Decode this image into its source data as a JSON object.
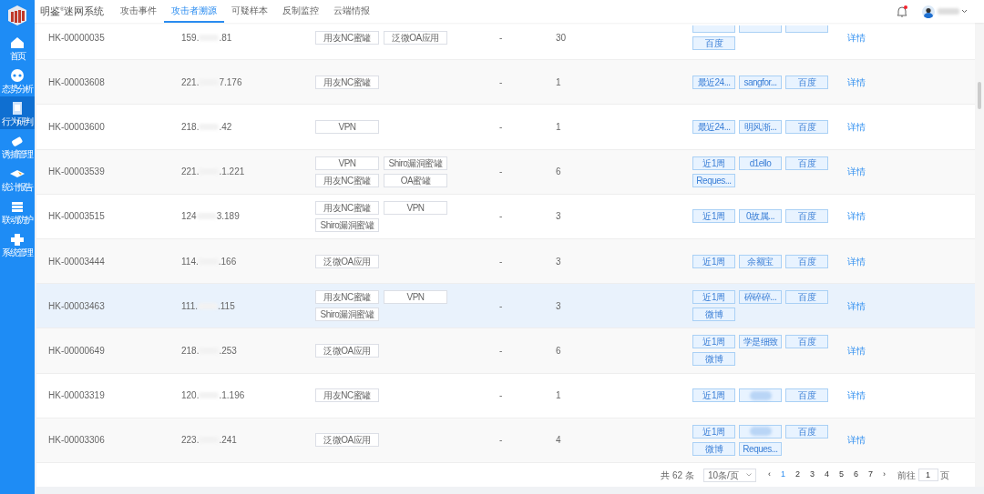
{
  "app": {
    "title": "明鉴$^{®}$迷网系统"
  },
  "sidebar": {
    "items": [
      {
        "label": "首页",
        "selected": false
      },
      {
        "label": "态势分析",
        "selected": false
      },
      {
        "label": "行为研判",
        "selected": true
      },
      {
        "label": "诱捕管理",
        "selected": false
      },
      {
        "label": "统计报告",
        "selected": false
      },
      {
        "label": "联动防护",
        "selected": false
      },
      {
        "label": "系统管理",
        "selected": false
      }
    ]
  },
  "tabs": [
    {
      "label": "攻击事件",
      "selected": false
    },
    {
      "label": "攻击者溯源",
      "selected": true
    },
    {
      "label": "可疑样本",
      "selected": false
    },
    {
      "label": "反制监控",
      "selected": false
    },
    {
      "label": "云端情报",
      "selected": false
    }
  ],
  "header": {
    "notifications": {
      "unread": true
    }
  },
  "table": {
    "rows": [
      {
        "id": "HK-00000035",
        "ip_start": "159.",
        "ip_end": ".81",
        "tags": [
          "用友NC蜜罐",
          "泛微OA应用"
        ],
        "dash": "-",
        "count": "30",
        "intel": [
          {
            "kind": "clipped"
          },
          {
            "kind": "clipped"
          },
          {
            "kind": "clipped"
          },
          {
            "kind": "text",
            "text": "百度"
          }
        ],
        "action": "详情",
        "highlighted": false
      },
      {
        "id": "HK-00003608",
        "ip_start": "221.",
        "ip_end": "7.176",
        "tags": [
          "用友NC蜜罐"
        ],
        "dash": "-",
        "count": "1",
        "intel": [
          {
            "kind": "text",
            "text": "最近24..."
          },
          {
            "kind": "text",
            "text": "sangfor..."
          },
          {
            "kind": "text",
            "text": "百度"
          }
        ],
        "action": "详情",
        "highlighted": false
      },
      {
        "id": "HK-00003600",
        "ip_start": "218.",
        "ip_end": ".42",
        "tags": [
          "VPN"
        ],
        "dash": "-",
        "count": "1",
        "intel": [
          {
            "kind": "text",
            "text": "最近24..."
          },
          {
            "kind": "text",
            "text": "明风渐..."
          },
          {
            "kind": "text",
            "text": "百度"
          }
        ],
        "action": "详情",
        "highlighted": false
      },
      {
        "id": "HK-00003539",
        "ip_start": "221.",
        "ip_end": ".1.221",
        "tags": [
          "VPN",
          "Shiro漏洞蜜罐",
          "用友NC蜜罐",
          "OA蜜罐"
        ],
        "dash": "-",
        "count": "6",
        "intel": [
          {
            "kind": "text",
            "text": "近1周"
          },
          {
            "kind": "text",
            "text": "d1ello"
          },
          {
            "kind": "text",
            "text": "百度"
          },
          {
            "kind": "text",
            "text": "Reques..."
          }
        ],
        "action": "详情",
        "highlighted": false
      },
      {
        "id": "HK-00003515",
        "ip_start": "124",
        "ip_end": "3.189",
        "tags": [
          "用友NC蜜罐",
          "VPN",
          "Shiro漏洞蜜罐"
        ],
        "dash": "-",
        "count": "3",
        "intel": [
          {
            "kind": "text",
            "text": "近1周"
          },
          {
            "kind": "text",
            "text": "0故属..."
          },
          {
            "kind": "text",
            "text": "百度"
          }
        ],
        "action": "详情",
        "highlighted": false
      },
      {
        "id": "HK-00003444",
        "ip_start": "114.",
        "ip_end": ".166",
        "tags": [
          "泛微OA应用"
        ],
        "dash": "-",
        "count": "3",
        "intel": [
          {
            "kind": "text",
            "text": "近1周"
          },
          {
            "kind": "text",
            "text": "余额宝"
          },
          {
            "kind": "text",
            "text": "百度"
          }
        ],
        "action": "详情",
        "highlighted": false
      },
      {
        "id": "HK-00003463",
        "ip_start": "111.",
        "ip_end": ".115",
        "tags": [
          "用友NC蜜罐",
          "VPN",
          "Shiro漏洞蜜罐"
        ],
        "dash": "-",
        "count": "3",
        "intel": [
          {
            "kind": "text",
            "text": "近1周"
          },
          {
            "kind": "text",
            "text": "碎碎碎..."
          },
          {
            "kind": "text",
            "text": "百度"
          },
          {
            "kind": "text",
            "text": "微博"
          }
        ],
        "action": "详情",
        "highlighted": true
      },
      {
        "id": "HK-00000649",
        "ip_start": "218.",
        "ip_end": ".253",
        "tags": [
          "泛微OA应用"
        ],
        "dash": "-",
        "count": "6",
        "intel": [
          {
            "kind": "text",
            "text": "近1周"
          },
          {
            "kind": "text",
            "text": "学是细致"
          },
          {
            "kind": "text",
            "text": "百度"
          },
          {
            "kind": "text",
            "text": "微博"
          }
        ],
        "action": "详情",
        "highlighted": false
      },
      {
        "id": "HK-00003319",
        "ip_start": "120.",
        "ip_end": ".1.196",
        "tags": [
          "用友NC蜜罐"
        ],
        "dash": "-",
        "count": "1",
        "intel": [
          {
            "kind": "text",
            "text": "近1周"
          },
          {
            "kind": "blurred"
          },
          {
            "kind": "text",
            "text": "百度"
          }
        ],
        "action": "详情",
        "highlighted": false
      },
      {
        "id": "HK-00003306",
        "ip_start": "223.",
        "ip_end": ".241",
        "tags": [
          "泛微OA应用"
        ],
        "dash": "-",
        "count": "4",
        "intel": [
          {
            "kind": "text",
            "text": "近1周"
          },
          {
            "kind": "blurred"
          },
          {
            "kind": "text",
            "text": "百度"
          },
          {
            "kind": "text",
            "text": "微博"
          },
          {
            "kind": "text",
            "text": "Reques..."
          }
        ],
        "action": "详情",
        "highlighted": false
      }
    ]
  },
  "pagination": {
    "total": "共 62 条",
    "page_size": "10条/页",
    "prev": "‹",
    "pages": [
      {
        "label": "1",
        "selected": true
      },
      {
        "label": "2",
        "selected": false
      },
      {
        "label": "3",
        "selected": false
      },
      {
        "label": "4",
        "selected": false
      },
      {
        "label": "5",
        "selected": false
      },
      {
        "label": "6",
        "selected": false
      },
      {
        "label": "7",
        "selected": false
      }
    ],
    "next": "›",
    "goto_label": "前往",
    "goto_value": "1",
    "goto_suffix": "页"
  }
}
